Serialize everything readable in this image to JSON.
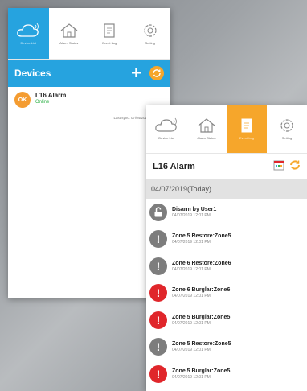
{
  "left": {
    "nav": [
      {
        "label": "Device List",
        "icon": "cloud-icon"
      },
      {
        "label": "Alarm Status",
        "icon": "house-icon"
      },
      {
        "label": "Event Log",
        "icon": "log-icon"
      },
      {
        "label": "Setting",
        "icon": "gear-icon"
      }
    ],
    "devices_title": "Devices",
    "device": {
      "badge": "OK",
      "name": "L16 Alarm",
      "status": "Online"
    },
    "last_sync": "Last sync: 07/04/2019 12:11:14"
  },
  "right": {
    "nav": [
      {
        "label": "Device List",
        "icon": "cloud-icon"
      },
      {
        "label": "Alarm Status",
        "icon": "house-icon"
      },
      {
        "label": "Event Log",
        "icon": "log-icon"
      },
      {
        "label": "Setting",
        "icon": "gear-icon"
      }
    ],
    "title": "L16 Alarm",
    "date_header": "04/07/2019(Today)",
    "events": [
      {
        "title": "Disarm by User1",
        "time": "04/07/2019 12:01 PM",
        "type": "lock",
        "color": "#7d7d7d"
      },
      {
        "title": "Zone 5 Restore:Zone5",
        "time": "04/07/2019 12:01 PM",
        "type": "info",
        "color": "#7d7d7d"
      },
      {
        "title": "Zone 6 Restore:Zone6",
        "time": "04/07/2019 12:01 PM",
        "type": "info",
        "color": "#7d7d7d"
      },
      {
        "title": "Zone 6 Burglar:Zone6",
        "time": "04/07/2019 12:01 PM",
        "type": "alarm",
        "color": "#e0262b"
      },
      {
        "title": "Zone 5 Burglar:Zone5",
        "time": "04/07/2019 12:01 PM",
        "type": "alarm",
        "color": "#e0262b"
      },
      {
        "title": "Zone 5 Restore:Zone5",
        "time": "04/07/2019 12:01 PM",
        "type": "info",
        "color": "#7d7d7d"
      },
      {
        "title": "Zone 5 Burglar:Zone5",
        "time": "04/07/2019 12:01 PM",
        "type": "alarm",
        "color": "#e0262b"
      }
    ]
  },
  "colors": {
    "blue": "#26a3df",
    "orange": "#f6a62b",
    "online": "#32b24a",
    "alarm": "#e0262b",
    "grey": "#7d7d7d"
  }
}
